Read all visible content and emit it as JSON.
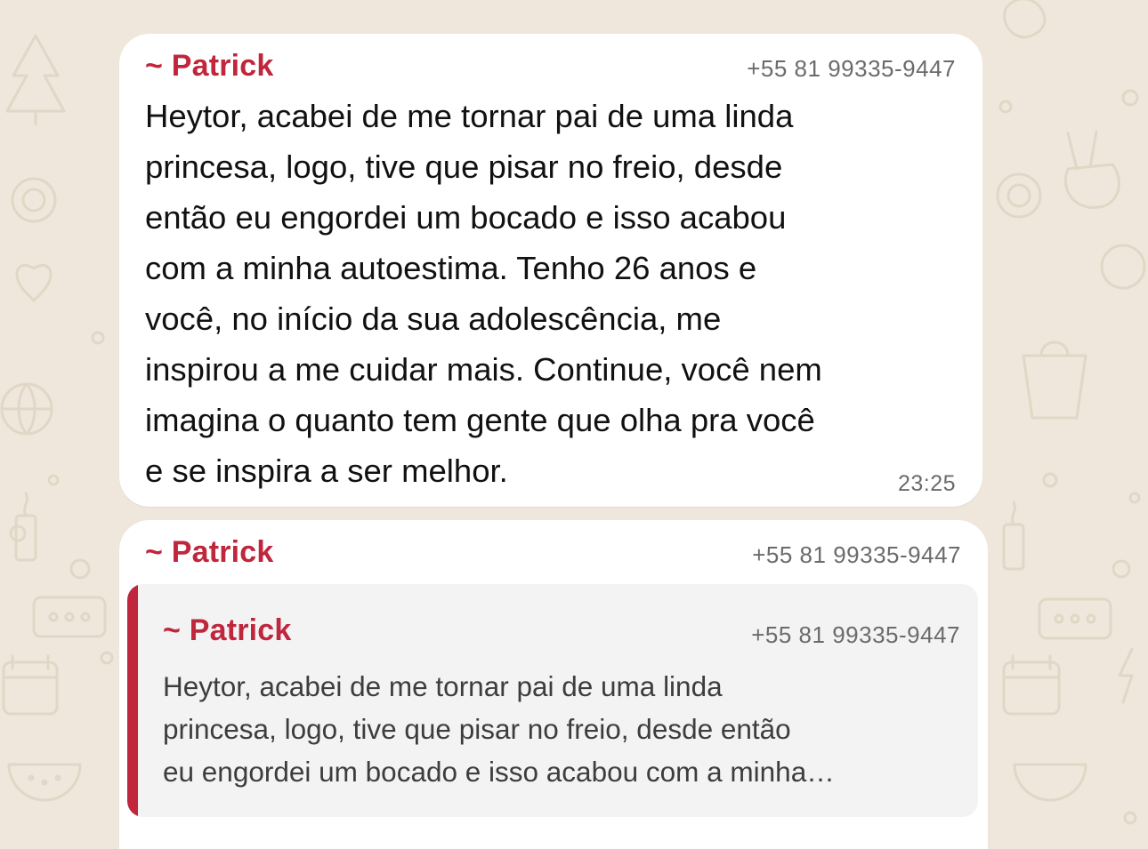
{
  "theme": {
    "wallpaper_color": "#efe7dc",
    "doodle_color": "#e2d7c6",
    "sender_color": "#c0263c",
    "quote_background": "#f3f3f4"
  },
  "messages": [
    {
      "sender": "~ Patrick",
      "phone": "+55 81 99335-9447",
      "text": "Heytor, acabei de me tornar pai de uma linda\nprincesa, logo, tive que pisar no freio, desde\nentão eu engordei um bocado e isso acabou\ncom a minha autoestima. Tenho 26 anos e\nvocê, no início da sua adolescência, me\ninspirou a me cuidar mais. Continue, você nem\nimagina o quanto tem gente que olha pra você\ne se inspira a ser melhor.",
      "time": "23:25"
    },
    {
      "sender": "~ Patrick",
      "phone": "+55 81 99335-9447",
      "quote": {
        "sender": "~ Patrick",
        "phone": "+55 81 99335-9447",
        "text": "Heytor, acabei de me tornar pai de uma linda\nprincesa, logo, tive que pisar no freio, desde então\neu engordei um bocado e isso acabou com a minha…"
      }
    }
  ]
}
